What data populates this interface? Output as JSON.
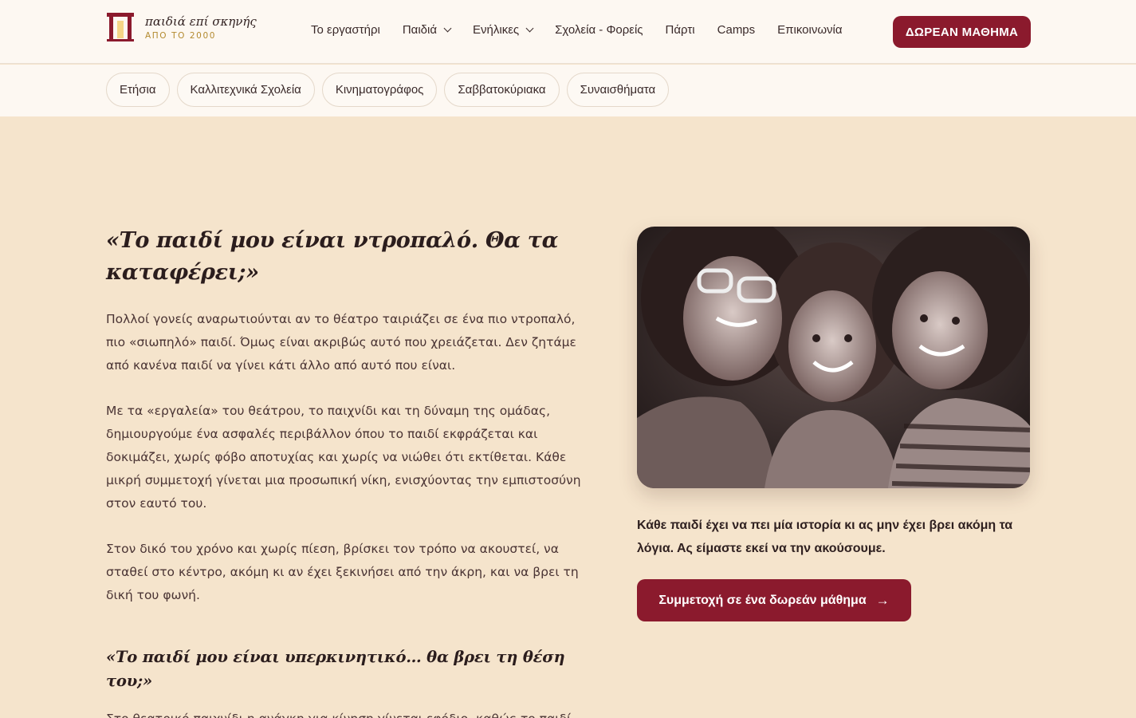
{
  "brand": {
    "name": "παιδιά επί σκηνής",
    "since": "ΑΠΟ ΤΟ 2000",
    "accent": "#8b1a2d",
    "gold": "#b38a2f"
  },
  "nav": {
    "items": [
      {
        "label": "Το εργαστήρι",
        "dropdown": false
      },
      {
        "label": "Παιδιά",
        "dropdown": true
      },
      {
        "label": "Ενήλικες",
        "dropdown": true
      },
      {
        "label": "Σχολεία - Φορείς",
        "dropdown": false
      },
      {
        "label": "Πάρτι",
        "dropdown": false
      },
      {
        "label": "Camps",
        "dropdown": false
      },
      {
        "label": "Επικοινωνία",
        "dropdown": false
      }
    ],
    "cta": "ΔΩΡΕΑΝ ΜΑΘΗΜΑ"
  },
  "subnav": [
    "Ετήσια",
    "Καλλιτεχνικά Σχολεία",
    "Κινηματογράφος",
    "Σαββατοκύριακα",
    "Συναισθήματα"
  ],
  "main": {
    "heading": "«Το παιδί μου είναι ντροπαλό. Θα τα καταφέρει;»",
    "paragraphs": [
      "Πολλοί γονείς αναρωτιούνται αν το θέατρο ταιριάζει σε ένα πιο ντροπαλό, πιο «σιωπηλό» παιδί. Όμως είναι ακριβώς αυτό που χρειάζεται. Δεν ζητάμε από κανένα παιδί να γίνει κάτι άλλο από αυτό που είναι.",
      "Με τα «εργαλεία» του θεάτρου, το παιχνίδι και τη δύναμη της ομάδας, δημιουργούμε ένα ασφαλές περιβάλλον όπου το παιδί εκφράζεται και δοκιμάζει, χωρίς φόβο αποτυχίας και χωρίς να νιώθει ότι εκτίθεται. Κάθε μικρή συμμετοχή γίνεται μια προσωπική νίκη, ενισχύοντας την εμπιστοσύνη στον εαυτό του.",
      "Στον δικό του χρόνο και χωρίς πίεση, βρίσκει τον τρόπο να ακουστεί, να σταθεί στο κέντρο, ακόμη κι αν έχει ξεκινήσει από την άκρη, και να βρει τη δική του φωνή."
    ],
    "subheading": "«Το παιδί μου είναι υπερκινητικό… θα βρει τη θέση του;»",
    "paragraph2": "Στο θεατρικό παιχνίδι η ανάγκη για κίνηση γίνεται εφόδιο, καθώς το παιδί βρίσκει τρόπους να διοχετεύει την ενέργειά του σε δημιουργική έκφραση. Με"
  },
  "aside": {
    "quote": "Κάθε παιδί έχει να πει μία ιστορία κι ας μην έχει βρει ακόμη τα λόγια. Ας είμαστε εκεί να την ακούσουμε.",
    "cta": "Συμμετοχή σε ένα δωρεάν μάθημα",
    "cta_arrow": "→"
  }
}
